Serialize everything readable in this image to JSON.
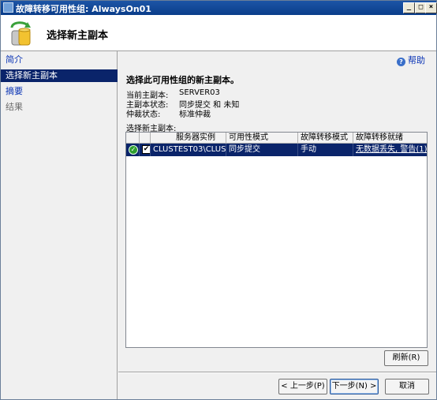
{
  "window": {
    "title": "故障转移可用性组: AlwaysOn01",
    "minimize_glyph": "_",
    "maximize_glyph": "□",
    "close_glyph": "×"
  },
  "header": {
    "page_title": "选择新主副本"
  },
  "sidebar": {
    "items": [
      {
        "label": "简介",
        "state": "link"
      },
      {
        "label": "选择新主副本",
        "state": "active"
      },
      {
        "label": "摘要",
        "state": "link"
      },
      {
        "label": "结果",
        "state": "disabled"
      }
    ]
  },
  "content": {
    "help_label": "帮助",
    "instruction": "选择此可用性组的新主副本。",
    "info": [
      {
        "label": "当前主副本:",
        "value": "SERVER03"
      },
      {
        "label": "主副本状态:",
        "value": "同步提交 和 未知"
      },
      {
        "label": "仲裁状态:",
        "value": "标准仲裁"
      }
    ],
    "list_label": "选择新主副本:",
    "grid": {
      "columns": [
        "服务器实例",
        "可用性模式",
        "故障转移模式",
        "故障转移就绪"
      ],
      "rows": [
        {
          "selected": true,
          "checked": true,
          "status_glyph": "✓",
          "check_glyph": "✔",
          "server_instance": "CLUSTEST03\\CLUST...",
          "availability_mode": "同步提交",
          "failover_mode": "手动",
          "failover_readiness": "无数据丢失, 警告(1)"
        }
      ]
    },
    "refresh_button": "刷新(R)"
  },
  "footer": {
    "prev_button": "< 上一步(P)",
    "next_button": "下一步(N) >",
    "cancel_button": "取消"
  },
  "colors": {
    "title_bar": "#0a3d8a",
    "selection": "#0a246a",
    "link": "#0a34b5",
    "status_ok": "#2f9e2f"
  }
}
